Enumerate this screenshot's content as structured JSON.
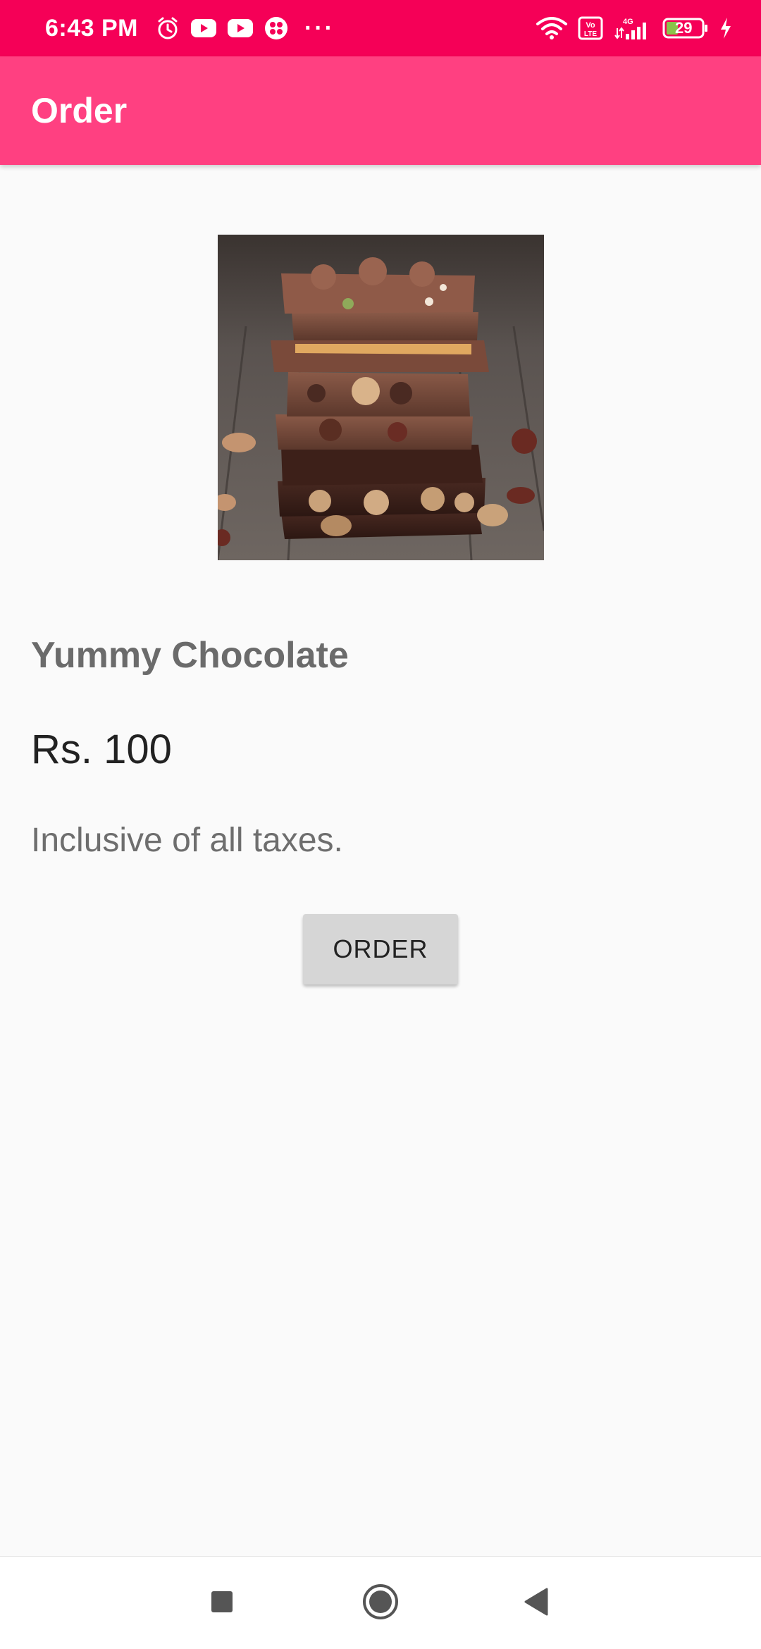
{
  "status_bar": {
    "time": "6:43 PM",
    "more": "···",
    "battery_level": "29",
    "icons": [
      "alarm-icon",
      "youtube-icon",
      "youtube-icon",
      "app-icon",
      "wifi-icon",
      "volte-icon",
      "signal-4g-icon",
      "battery-icon",
      "charging-icon"
    ]
  },
  "app_bar": {
    "title": "Order",
    "color": "#ff4081",
    "status_color": "#f50057"
  },
  "product": {
    "image": "chocolate-stack-image",
    "name": "Yummy Chocolate",
    "price": "Rs. 100",
    "tax_note": "Inclusive of all taxes.",
    "order_label": "ORDER"
  },
  "nav_bar": {
    "icons": [
      "recent-apps-icon",
      "home-icon",
      "back-icon"
    ]
  }
}
